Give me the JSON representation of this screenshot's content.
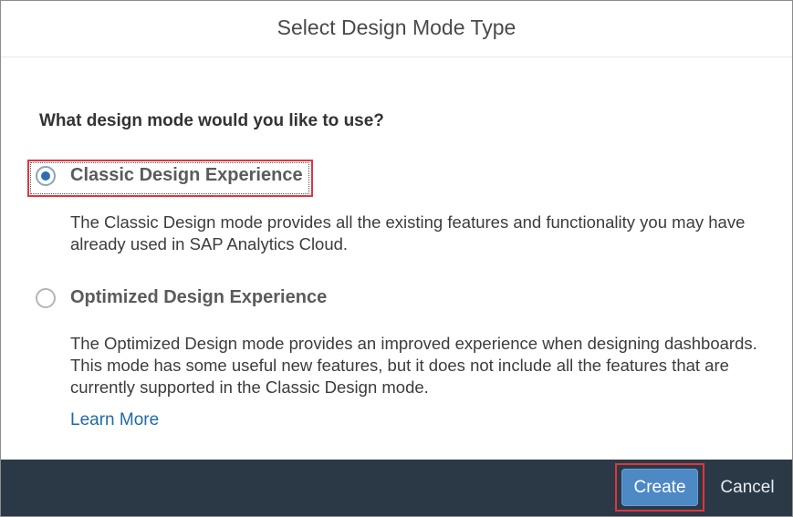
{
  "dialog": {
    "title": "Select Design Mode Type",
    "question": "What design mode would you like to use?",
    "options": [
      {
        "label": "Classic Design Experience",
        "description": "The Classic Design mode provides all the existing features and functionality you may have already used in SAP Analytics Cloud.",
        "selected": true
      },
      {
        "label": "Optimized Design Experience",
        "description": "The Optimized Design mode provides an improved experience when designing dashboards. This mode has some useful new features, but it does not include all the features that are currently supported in the Classic Design mode.",
        "selected": false
      }
    ],
    "learn_more": "Learn More"
  },
  "footer": {
    "create_label": "Create",
    "cancel_label": "Cancel"
  },
  "colors": {
    "footer_bg": "#2b3947",
    "primary_button": "#4d89c4",
    "link": "#1f6aa8",
    "highlight_border": "#e0363d",
    "radio_selected": "#2c6fb5"
  },
  "icons": {
    "radio_selected": "radio-selected-icon",
    "radio_unselected": "radio-unselected-icon"
  }
}
